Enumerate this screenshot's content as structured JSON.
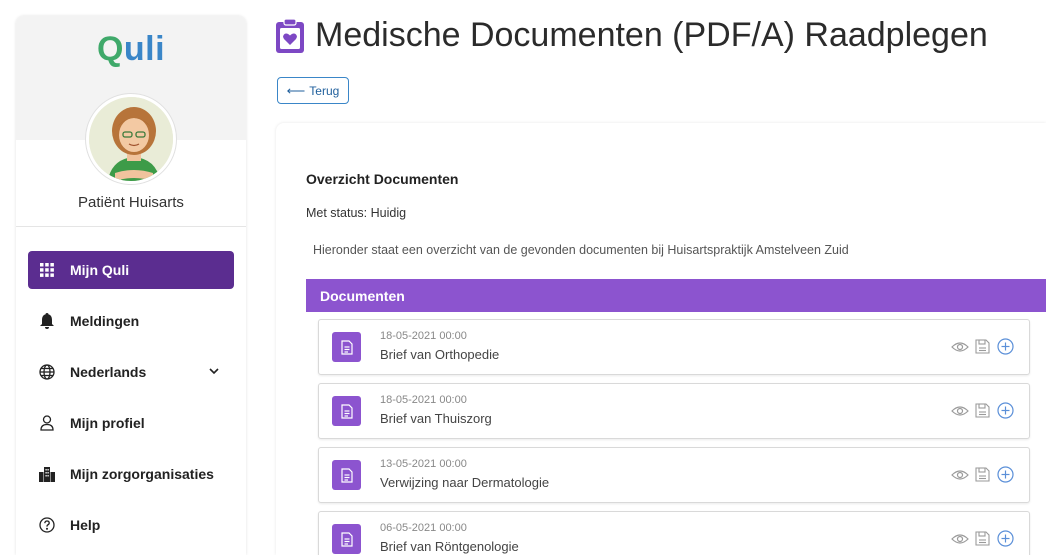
{
  "sidebar": {
    "logo": {
      "first": "Q",
      "rest": "uli"
    },
    "user_name": "Patiënt Huisarts",
    "items": [
      {
        "label": "Mijn Quli",
        "icon": "grid-icon",
        "active": true
      },
      {
        "label": "Meldingen",
        "icon": "bell-icon"
      },
      {
        "label": "Nederlands",
        "icon": "globe-icon",
        "has_dropdown": true
      },
      {
        "label": "Mijn profiel",
        "icon": "user-icon"
      },
      {
        "label": "Mijn zorgorganisaties",
        "icon": "building-icon"
      },
      {
        "label": "Help",
        "icon": "help-circle-icon"
      }
    ]
  },
  "page": {
    "title": "Medische Documenten (PDF/A) Raadplegen",
    "back_label": "Terug"
  },
  "panel": {
    "heading": "Overzicht Documenten",
    "status": "Met status: Huidig",
    "intro": "Hieronder staat een overzicht van de gevonden documenten bij Huisartspraktijk Amstelveen Zuid",
    "documents_header": "Documenten"
  },
  "documents": [
    {
      "date": "18-05-2021 00:00",
      "title": "Brief van Orthopedie"
    },
    {
      "date": "18-05-2021 00:00",
      "title": "Brief van Thuiszorg"
    },
    {
      "date": "13-05-2021 00:00",
      "title": "Verwijzing naar Dermatologie"
    },
    {
      "date": "06-05-2021 00:00",
      "title": "Brief van Röntgenologie"
    }
  ],
  "colors": {
    "accent_purple": "#5b2d90",
    "doc_purple": "#8c54cf",
    "link_blue": "#3a86c8",
    "logo_green": "#3fa96a"
  }
}
